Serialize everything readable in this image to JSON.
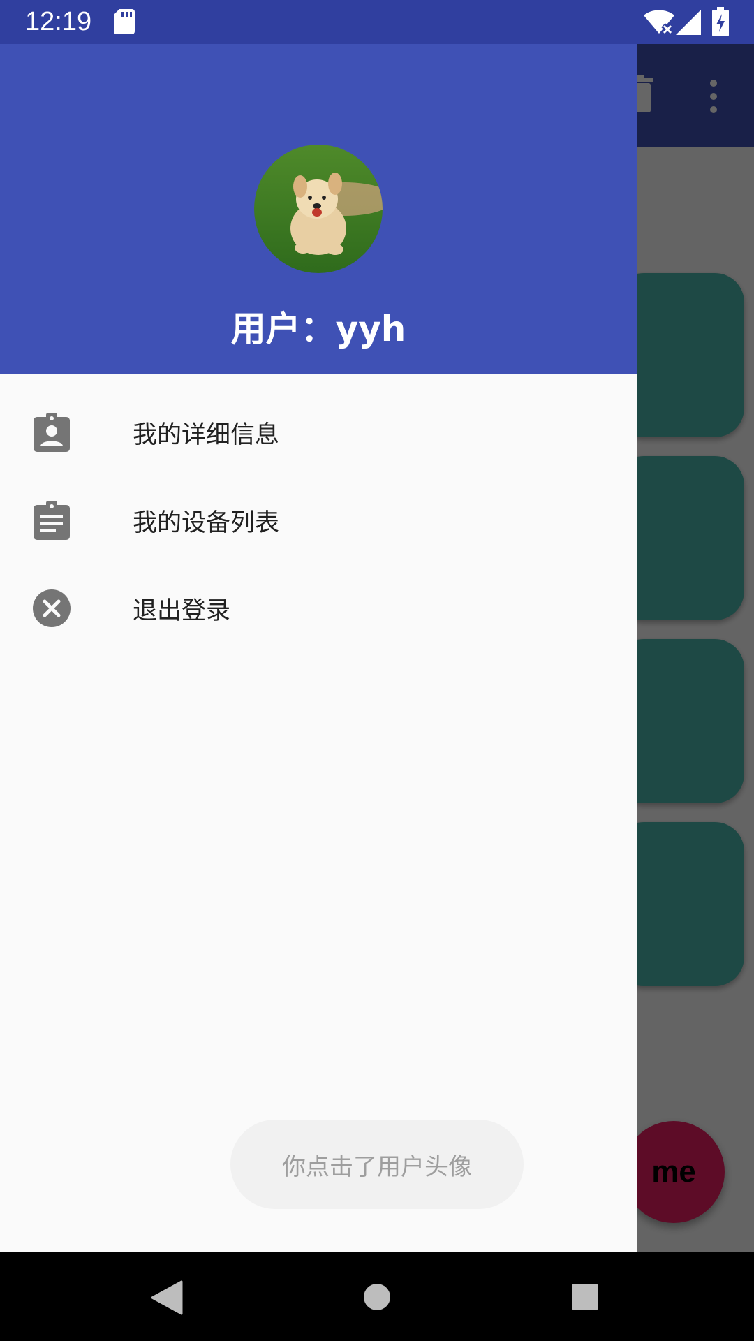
{
  "status_bar": {
    "time": "12:19",
    "icons": [
      "sd-card-icon",
      "wifi-off-icon",
      "signal-icon",
      "battery-charging-icon"
    ]
  },
  "colors": {
    "primary": "#3F51B5",
    "primary_dark": "#303F9F",
    "card": "#4DB6AC",
    "fab": "#E91E63"
  },
  "drawer": {
    "user_label": "用户：yyh",
    "menu": [
      {
        "label": "我的详细信息",
        "icon": "account-badge-icon"
      },
      {
        "label": "我的设备列表",
        "icon": "clipboard-list-icon"
      },
      {
        "label": "退出登录",
        "icon": "cancel-circle-icon"
      }
    ]
  },
  "background_app": {
    "toolbar_icons": [
      "delete-icon",
      "overflow-menu-icon"
    ],
    "fab_label": "me"
  },
  "toast": {
    "text": "你点击了用户头像"
  },
  "nav_bar": {
    "icons": [
      "back-icon",
      "home-icon",
      "recents-icon"
    ]
  }
}
